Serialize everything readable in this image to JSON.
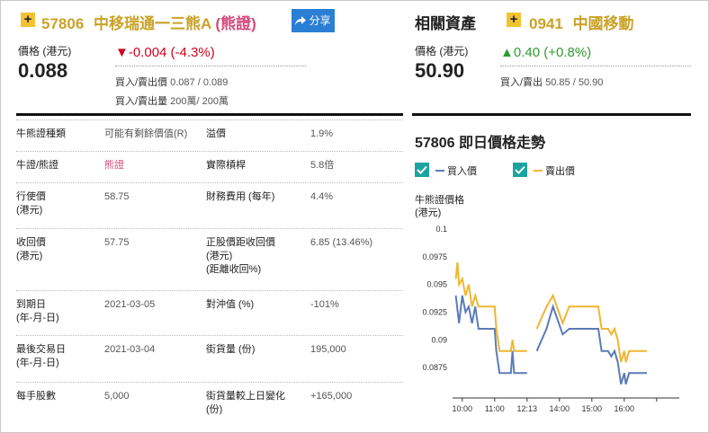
{
  "left": {
    "code": "57806",
    "name": "中移瑞通一三熊A",
    "tag": "(熊證)",
    "share_label": "分享",
    "price_label": "價格 (港元)",
    "price": "0.088",
    "change": "▼-0.004 (-4.3%)",
    "bid_ask_label": "買入/賣出價",
    "bid_ask": "0.087 / 0.089",
    "volume_label": "買入/賣出量",
    "volume": "200萬/ 200萬"
  },
  "right": {
    "related_label": "相關資產",
    "code": "0941",
    "name": "中國移動",
    "price_label": "價格 (港元)",
    "price": "50.90",
    "change": "▲0.40 (+0.8%)",
    "bid_ask_label": "買入/賣出",
    "bid_ask": "50.85 / 50.90"
  },
  "table": [
    {
      "k1": "牛熊證種類",
      "v1": "可能有剩餘價值(R)",
      "k2": "溢價",
      "v2": "1.9%"
    },
    {
      "k1": "牛證/熊證",
      "v1": "熊證",
      "k2": "實際槓桿",
      "v2": "5.8倍"
    },
    {
      "k1": "行使價\n(港元)",
      "v1": "58.75",
      "k2": "財務費用 (每年)",
      "v2": "4.4%"
    },
    {
      "k1": "收回價\n(港元)",
      "v1": "57.75",
      "k2": "正股價距收回價\n(港元)\n(距離收回%)",
      "v2": "6.85 (13.46%)"
    },
    {
      "k1": "到期日\n(年-月-日)",
      "v1": "2021-03-05",
      "k2": "對沖值 (%)",
      "v2": "-101%"
    },
    {
      "k1": "最後交易日\n(年-月-日)",
      "v1": "2021-03-04",
      "k2": "街貨量 (份)",
      "v2": "195,000"
    },
    {
      "k1": "每手股數",
      "v1": "5,000",
      "k2": "街貨量較上日變化\n(份)",
      "v2": "+165,000"
    }
  ],
  "chart_section": {
    "title": "57806 即日價格走勢",
    "legend_bid": "買入價",
    "legend_ask": "賣出價"
  },
  "chart_data": {
    "type": "line",
    "ylabel": "牛熊證價格\n(港元)",
    "ylim": [
      0.085,
      0.1
    ],
    "yticks": [
      "0.1",
      "0.0975",
      "0.095",
      "0.0925",
      "0.09",
      "0.0875"
    ],
    "ytick_values": [
      0.1,
      0.0975,
      0.095,
      0.0925,
      0.09,
      0.0875
    ],
    "xlim": [
      9.7,
      16.7
    ],
    "xticks": [
      "10:00",
      "11:00",
      "12:13",
      "14:00",
      "15:00",
      "16:00"
    ],
    "xtick_values": [
      10.0,
      11.0,
      12.0,
      13.0,
      14.0,
      15.0,
      16.0
    ],
    "series": [
      {
        "name": "買入價",
        "color": "#5b7bb8",
        "segments": [
          [
            [
              9.8,
              0.094
            ],
            [
              9.9,
              0.0915
            ],
            [
              10.0,
              0.094
            ],
            [
              10.1,
              0.0925
            ],
            [
              10.2,
              0.093
            ],
            [
              10.3,
              0.0915
            ],
            [
              10.4,
              0.093
            ],
            [
              10.5,
              0.091
            ],
            [
              10.6,
              0.091
            ],
            [
              11.0,
              0.091
            ],
            [
              11.05,
              0.089
            ],
            [
              11.15,
              0.087
            ],
            [
              11.5,
              0.087
            ],
            [
              11.55,
              0.089
            ],
            [
              11.6,
              0.087
            ],
            [
              12.0,
              0.087
            ]
          ],
          [
            [
              12.3,
              0.089
            ],
            [
              12.6,
              0.091
            ],
            [
              12.8,
              0.093
            ],
            [
              13.1,
              0.0905
            ],
            [
              13.3,
              0.091
            ],
            [
              14.2,
              0.091
            ],
            [
              14.3,
              0.089
            ],
            [
              14.5,
              0.089
            ],
            [
              14.6,
              0.0885
            ],
            [
              14.7,
              0.089
            ],
            [
              14.8,
              0.088
            ],
            [
              14.9,
              0.086
            ],
            [
              15.0,
              0.087
            ],
            [
              15.05,
              0.086
            ],
            [
              15.15,
              0.087
            ],
            [
              15.7,
              0.087
            ]
          ]
        ]
      },
      {
        "name": "賣出價",
        "color": "#f2b630",
        "segments": [
          [
            [
              9.8,
              0.0955
            ],
            [
              9.85,
              0.097
            ],
            [
              9.9,
              0.095
            ],
            [
              10.0,
              0.0955
            ],
            [
              10.1,
              0.094
            ],
            [
              10.2,
              0.095
            ],
            [
              10.3,
              0.093
            ],
            [
              10.4,
              0.094
            ],
            [
              10.5,
              0.093
            ],
            [
              10.6,
              0.093
            ],
            [
              11.0,
              0.093
            ],
            [
              11.05,
              0.091
            ],
            [
              11.15,
              0.089
            ],
            [
              11.5,
              0.089
            ],
            [
              11.55,
              0.09
            ],
            [
              11.6,
              0.089
            ],
            [
              12.0,
              0.089
            ]
          ],
          [
            [
              12.3,
              0.091
            ],
            [
              12.6,
              0.093
            ],
            [
              12.8,
              0.094
            ],
            [
              13.1,
              0.0915
            ],
            [
              13.3,
              0.093
            ],
            [
              14.2,
              0.093
            ],
            [
              14.3,
              0.091
            ],
            [
              14.5,
              0.091
            ],
            [
              14.6,
              0.0905
            ],
            [
              14.7,
              0.091
            ],
            [
              14.8,
              0.09
            ],
            [
              14.9,
              0.088
            ],
            [
              15.0,
              0.089
            ],
            [
              15.05,
              0.088
            ],
            [
              15.15,
              0.089
            ],
            [
              15.7,
              0.089
            ]
          ]
        ]
      }
    ]
  }
}
